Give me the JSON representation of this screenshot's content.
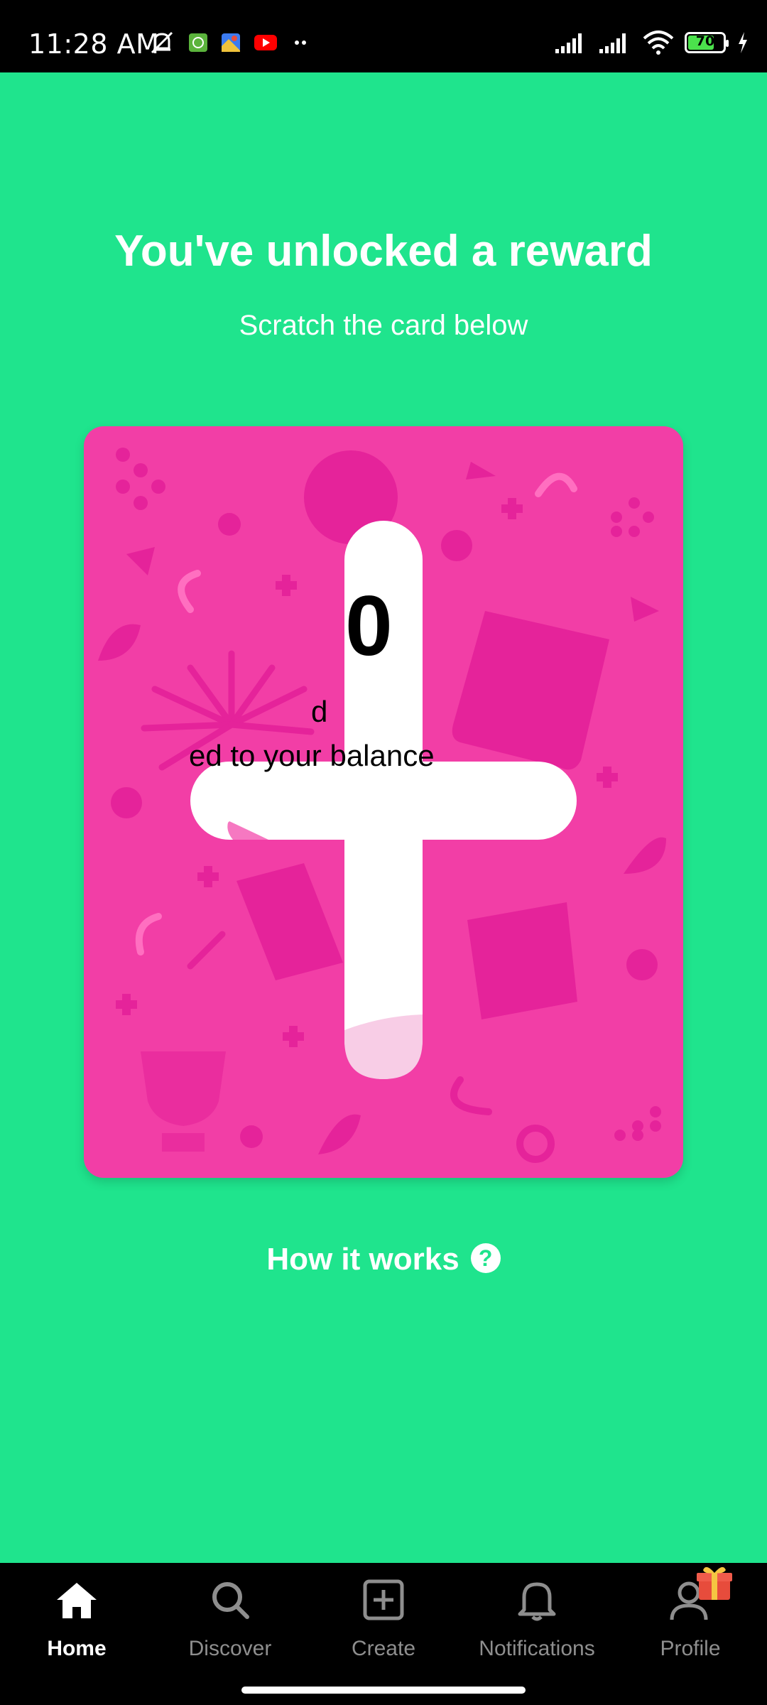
{
  "status_bar": {
    "time": "11:28 AM",
    "battery": "70",
    "icons": [
      "mute-icon",
      "app-icon",
      "photos-icon",
      "youtube-icon",
      "more-dots-icon",
      "signal-icon",
      "signal-icon",
      "wifi-icon",
      "battery-icon",
      "charging-icon"
    ]
  },
  "header": {
    "title": "You've unlocked a reward",
    "subtitle": "Scratch the card below"
  },
  "scratch_card": {
    "reveal_amount": "0",
    "reveal_line1": "d",
    "reveal_line2": "ed to your balance",
    "colors": {
      "card": "#f23ea6",
      "pattern": "#e5239a",
      "scratched": "#ffffff"
    }
  },
  "how_it_works": {
    "label": "How it works",
    "help_icon": "?"
  },
  "bottom_nav": {
    "items": [
      {
        "label": "Home",
        "icon": "home-icon",
        "active": true
      },
      {
        "label": "Discover",
        "icon": "search-icon",
        "active": false
      },
      {
        "label": "Create",
        "icon": "plus-square-icon",
        "active": false
      },
      {
        "label": "Notifications",
        "icon": "bell-icon",
        "active": false
      },
      {
        "label": "Profile",
        "icon": "user-icon",
        "active": false
      }
    ]
  },
  "theme": {
    "background": "#1fe48d",
    "nav_background": "#000000"
  }
}
